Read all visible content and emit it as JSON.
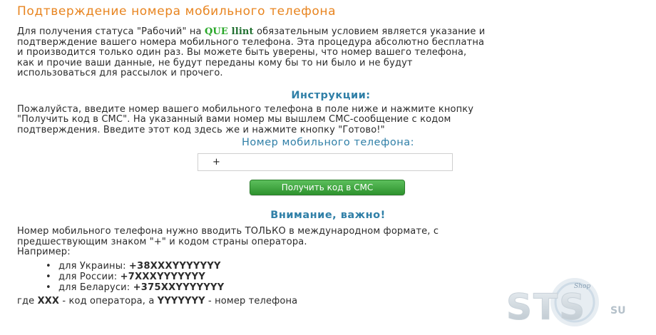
{
  "title": "Подтверждение номера мобильного телефона",
  "intro": {
    "part1": "Для получения статуса \"Рабочий\" на ",
    "brand_que": "QUE",
    "brand_llint": "llint",
    "part2": " обязательным условием является указание и",
    "line2": "подтверждение вашего номера мобильного телефона. Эта процедура абсолютно бесплатна",
    "line3": "и производится только один раз. Вы можете быть уверены, что номер вашего телефона,",
    "line4": "как и прочие ваши данные, не будут переданы кому бы то ни было и не будут",
    "line5": "использоваться для рассылок и прочего."
  },
  "instructions": {
    "heading": "Инструкции:",
    "line1": "Пожалуйста, введите номер вашего мобильного телефона в поле ниже и нажмите кнопку",
    "line2": "\"Получить код в СМС\". На указанный вами номер мы вышлем СМС-сообщение с кодом",
    "line3": "подтверждения. Введите этот код здесь же и нажмите кнопку \"Готово!\""
  },
  "phone": {
    "label": "Номер мобильного телефона:",
    "value": "+"
  },
  "button_label": "Получить код в СМС",
  "warning": {
    "heading": "Внимание, важно!",
    "line1": "Номер мобильного телефона нужно вводить ТОЛЬКО в международном формате, с",
    "line2": "предшествующим знаком \"+\" и кодом страны оператора.",
    "line3": "Например:"
  },
  "examples": [
    {
      "bullet": "•",
      "label": "для Украины: ",
      "value": "+38XXXYYYYYYY"
    },
    {
      "bullet": "•",
      "label": "для России: ",
      "value": "+7XXXYYYYYYY"
    },
    {
      "bullet": "•",
      "label": "для Беларуси: ",
      "value": "+375XXYYYYYYY"
    }
  ],
  "footnote": {
    "part1": "где ",
    "xxx": "XXX",
    "part2": " - код оператора, а ",
    "yyy": "YYYYYYY",
    "part3": " - номер телефона"
  },
  "watermark": {
    "main": "STS",
    "suffix": "SU",
    "badge": "Shop"
  },
  "colors": {
    "title": "#e8841f",
    "heading": "#2f7fa7",
    "brand_que": "#27a727",
    "brand_llint": "#1f6f2f",
    "button": "#3aa53a"
  }
}
